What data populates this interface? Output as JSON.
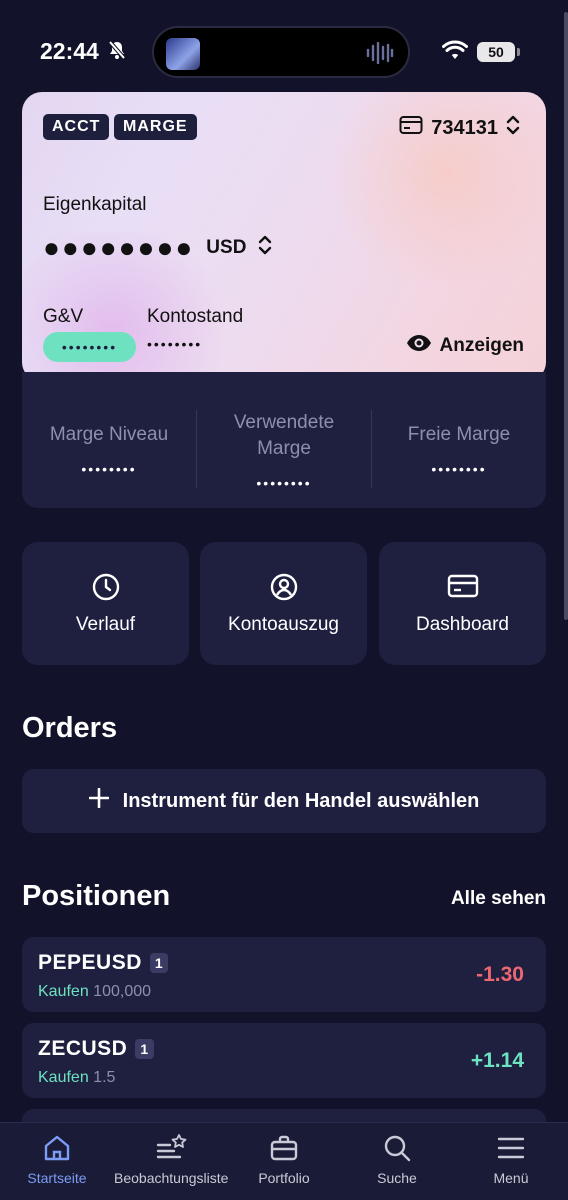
{
  "status_bar": {
    "time": "22:44",
    "battery": "50",
    "icons": [
      "bell-slash-icon",
      "audio-wave-icon",
      "wifi-icon",
      "battery-icon"
    ]
  },
  "account_card": {
    "tags": [
      "ACCT",
      "MARGE"
    ],
    "account_number": "734131",
    "equity_label": "Eigenkapital",
    "equity_masked": "●●●●●●●●",
    "currency": "USD",
    "pl_label": "G&V",
    "pl_masked": "••••••••",
    "balance_label": "Kontostand",
    "balance_masked": "••••••••",
    "show_label": "Anzeigen",
    "colors": {
      "pl_pill": "#6ee2c0",
      "tag_bg": "#1d1f3d"
    }
  },
  "margin": {
    "level_label": "Marge Niveau",
    "level_value": "••••••••",
    "used_label": "Verwendete Marge",
    "used_value": "••••••••",
    "free_label": "Freie Marge",
    "free_value": "••••••••"
  },
  "actions": [
    {
      "label": "Verlauf",
      "icon": "clock-icon"
    },
    {
      "label": "Kontoauszug",
      "icon": "user-circle-icon"
    },
    {
      "label": "Dashboard",
      "icon": "card-icon"
    }
  ],
  "orders": {
    "title": "Orders",
    "select_label": "Instrument für den Handel auswählen"
  },
  "positions": {
    "title": "Positionen",
    "see_all": "Alle sehen",
    "rows": [
      {
        "symbol": "PEPEUSD",
        "count": "1",
        "side": "Kaufen",
        "volume": "100,000",
        "pl": "-1.30"
      },
      {
        "symbol": "ZECUSD",
        "count": "1",
        "side": "Kaufen",
        "volume": "1.5",
        "pl": "+1.14"
      }
    ]
  },
  "tab_bar": {
    "tabs": [
      {
        "label": "Startseite",
        "icon": "home-icon",
        "active": true
      },
      {
        "label": "Beobachtungsliste",
        "icon": "watchlist-star-icon",
        "active": false
      },
      {
        "label": "Portfolio",
        "icon": "briefcase-icon",
        "active": false
      },
      {
        "label": "Suche",
        "icon": "search-icon",
        "active": false
      },
      {
        "label": "Menü",
        "icon": "menu-icon",
        "active": false
      }
    ],
    "active_color": "#7c9cf5"
  }
}
